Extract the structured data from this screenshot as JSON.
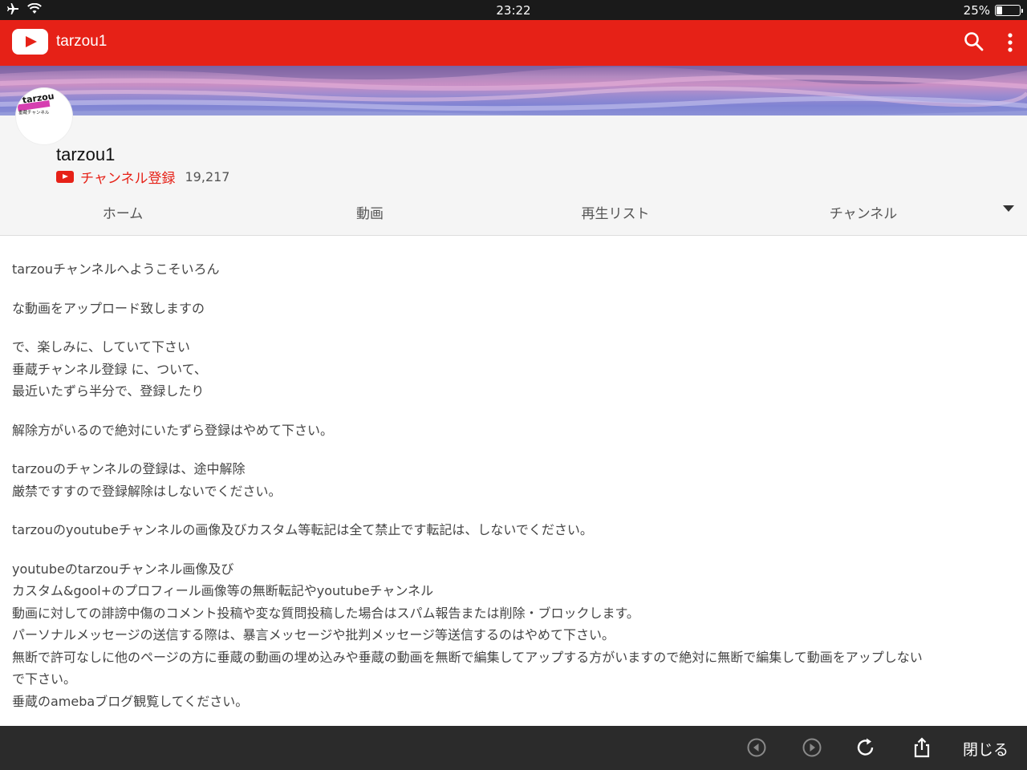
{
  "status_bar": {
    "time": "23:22",
    "battery": "25%",
    "battery_level": 0.25
  },
  "app_bar": {
    "title": "tarzou1",
    "search_icon": "search-icon",
    "more_icon": "more-vert-icon",
    "color": "#e62117"
  },
  "channel": {
    "name": "tarzou1",
    "avatar_text_line1": "tarzou",
    "avatar_text_line2": "垂蔵チャンネル",
    "subscribe_label": "チャンネル登録",
    "subscriber_count": "19,217"
  },
  "tabs": [
    {
      "label": "ホーム"
    },
    {
      "label": "動画"
    },
    {
      "label": "再生リスト"
    },
    {
      "label": "チャンネル"
    }
  ],
  "description": [
    "tarzouチャンネルへようこそいろん",
    "な動画をアップロード致しますの",
    "で、楽しみに、していて下さい\n垂蔵チャンネル登録 に、ついて、\n最近いたずら半分で、登録したり",
    "解除方がいるので絶対にいたずら登録はやめて下さい。",
    "tarzouのチャンネルの登録は、途中解除\n厳禁ですすので登録解除はしないでください。",
    "tarzouのyoutubeチャンネルの画像及びカスタム等転記は全て禁止です転記は、しないでください。",
    "youtubeのtarzouチャンネル画像及び\nカスタム&gool+のプロフィール画像等の無断転記やyoutubeチャンネル\n動画に対しての誹謗中傷のコメント投稿や変な質問投稿した場合はスパム報告または削除・ブロックします。\nパーソナルメッセージの送信する際は、暴言メッセージや批判メッセージ等送信するのはやめて下さい。\n無断で許可なしに他のページの方に垂蔵の動画の埋め込みや垂蔵の動画を無断で編集してアップする方がいますので絶対に無断で編集して動画をアップしない\nで下さい。\n垂蔵のamebaブログ観覧してください。"
  ],
  "bottom_bar": {
    "back_icon": "back-arrow-icon",
    "forward_icon": "forward-arrow-icon",
    "reload_icon": "reload-icon",
    "share_icon": "share-icon",
    "close_label": "閉じる"
  }
}
